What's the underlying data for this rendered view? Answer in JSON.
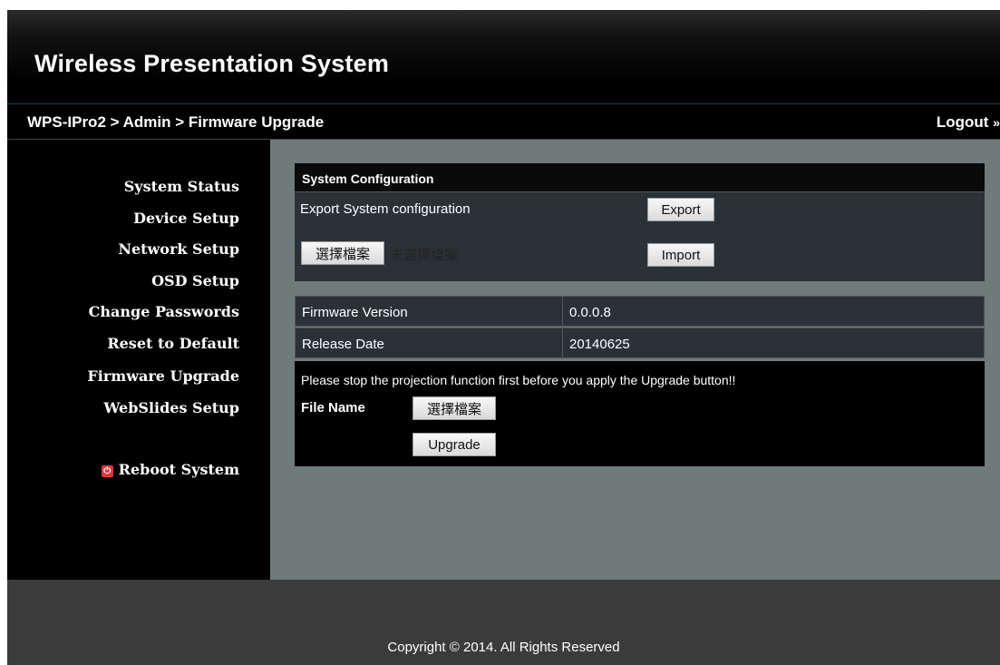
{
  "app": {
    "title": "Wireless Presentation System"
  },
  "nav": {
    "breadcrumb": "WPS-IPro2 > Admin > Firmware Upgrade",
    "logout_label": "Logout",
    "logout_arrow": "»"
  },
  "sidebar": {
    "items": [
      {
        "label": "System Status"
      },
      {
        "label": "Device Setup"
      },
      {
        "label": "Network Setup"
      },
      {
        "label": "OSD Setup"
      },
      {
        "label": "Change Passwords"
      },
      {
        "label": "Reset to Default"
      },
      {
        "label": "Firmware Upgrade"
      },
      {
        "label": "WebSlides Setup"
      }
    ],
    "reboot_label": "Reboot System",
    "reboot_icon": "power-icon"
  },
  "system_config": {
    "header": "System Configuration",
    "export_label": "Export System configuration",
    "export_button": "Export",
    "choose_file_button": "選擇檔案",
    "no_file_text": "未選擇檔案",
    "import_button": "Import"
  },
  "firmware": {
    "version_label": "Firmware Version",
    "version_value": "0.0.0.8",
    "release_label": "Release Date",
    "release_value": "20140625"
  },
  "upgrade": {
    "notice": "Please stop the projection function first before you apply the Upgrade button!!",
    "file_name_label": "File Name",
    "choose_file_button": "選擇檔案",
    "upgrade_button": "Upgrade"
  },
  "footer": {
    "copyright": "Copyright © 2014. All Rights Reserved"
  },
  "colors": {
    "main_bg": "#6f7a7b",
    "panel_bg": "#2b3237",
    "header_bg": "#000000",
    "footer_bg": "#3b3b3b",
    "reboot_icon": "#d9363e"
  }
}
